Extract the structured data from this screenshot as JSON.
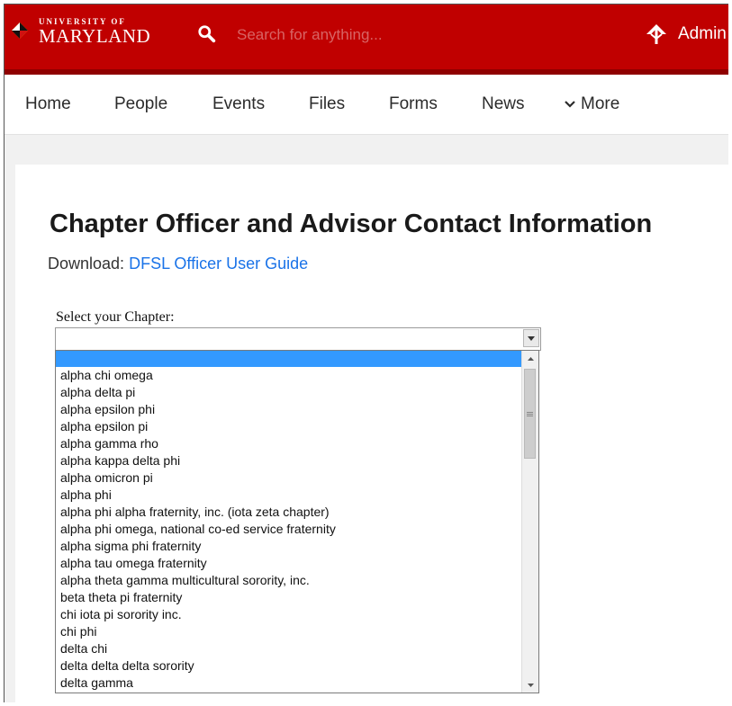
{
  "brand": {
    "university_of": "UNIVERSITY OF",
    "maryland": "MARYLAND"
  },
  "search": {
    "placeholder": "Search for anything...",
    "icon": "search-icon"
  },
  "user": {
    "label": "Admin",
    "icon": "umbrella-flag-icon"
  },
  "nav": {
    "home": "Home",
    "people": "People",
    "events": "Events",
    "files": "Files",
    "forms": "Forms",
    "news": "News",
    "more": "More"
  },
  "page": {
    "title": "Chapter Officer and Advisor Contact Information",
    "download_label": "Download:",
    "download_link": "DFSL Officer User Guide"
  },
  "chapter_select": {
    "label": "Select your Chapter:",
    "selected_value": "",
    "options": [
      "",
      "alpha chi omega",
      "alpha delta pi",
      "alpha epsilon phi",
      "alpha epsilon pi",
      "alpha gamma rho",
      "alpha kappa delta phi",
      "alpha omicron pi",
      "alpha phi",
      "alpha phi alpha fraternity, inc. (iota zeta chapter)",
      "alpha phi omega, national co-ed service fraternity",
      "alpha sigma phi fraternity",
      "alpha tau omega fraternity",
      "alpha theta gamma multicultural sorority, inc.",
      "beta theta pi fraternity",
      "chi iota pi sorority inc.",
      "chi phi",
      "delta chi",
      "delta delta delta sorority",
      "delta gamma"
    ]
  },
  "colors": {
    "header_red": "#c00000",
    "link_blue": "#1a73e8",
    "option_highlight": "#3399ff"
  }
}
